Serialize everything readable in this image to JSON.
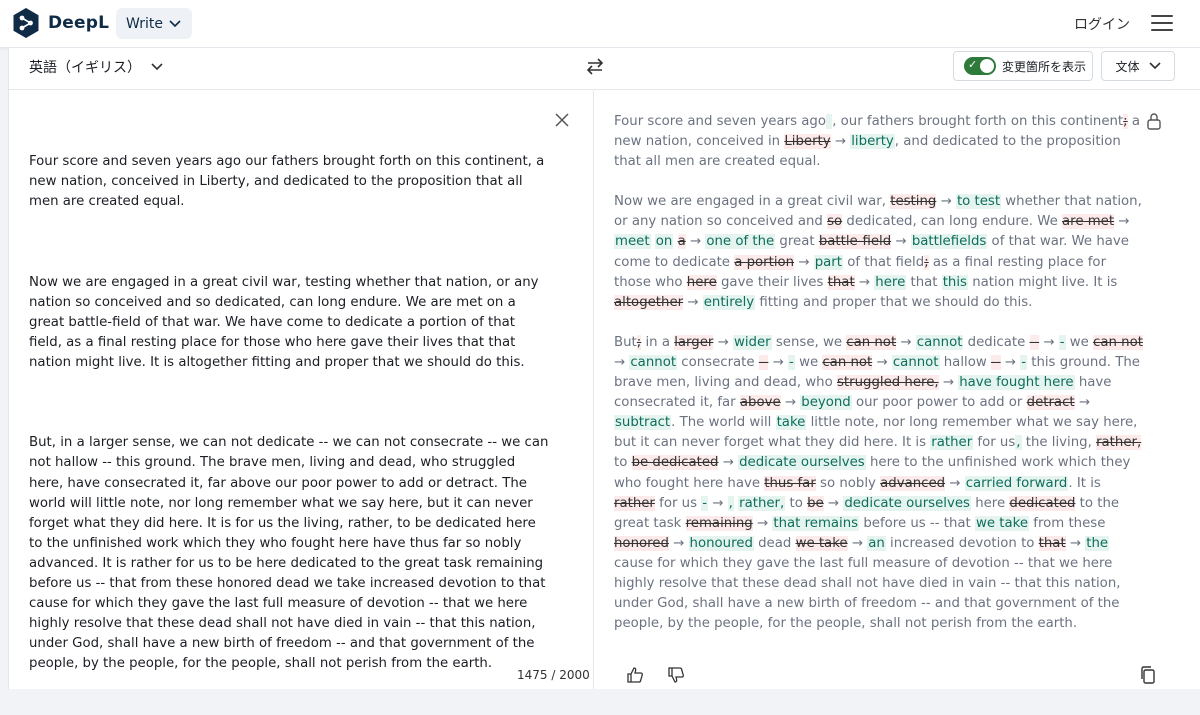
{
  "header": {
    "brand": "DeepL",
    "write_label": "Write",
    "login_label": "ログイン"
  },
  "source": {
    "language_label": "英語（イギリス）",
    "paragraphs": [
      "Four score and seven years ago our fathers brought forth on this continent, a new nation, conceived in Liberty, and dedicated to the proposition that all men are created equal.",
      "Now we are engaged in a great civil war, testing whether that nation, or any nation so conceived and so dedicated, can long endure. We are met on a great battle-field of that war. We have come to dedicate a portion of that field, as a final resting place for those who here gave their lives that that nation might live. It is altogether fitting and proper that we should do this.",
      "But, in a larger sense, we can not dedicate -- we can not consecrate -- we can not hallow -- this ground. The brave men, living and dead, who struggled here, have consecrated it, far above our poor power to add or detract. The world will little note, nor long remember what we say here, but it can never forget what they did here. It is for us the living, rather, to be dedicated here to the unfinished work which they who fought here have thus far so nobly advanced. It is rather for us to be here dedicated to the great task remaining before us -- that from these honored dead we take increased devotion to that cause for which they gave the last full measure of devotion -- that we here highly resolve that these dead shall not have died in vain -- that this nation, under God, shall have a new birth of freedom -- and that government of the people, by the people, for the people, shall not perish from the earth."
    ],
    "char_count": "1475 / 2000"
  },
  "target": {
    "show_changes_label": "変更箇所を表示",
    "style_label": "文体",
    "segments": [
      [
        {
          "t": "n",
          "s": "Four score and seven years ago"
        },
        {
          "t": "i",
          "s": " "
        },
        {
          "t": "n",
          "s": ", our fathers brought forth on this continent"
        },
        {
          "t": "d",
          "s": ";"
        },
        {
          "t": "n",
          "s": " a new nation, conceived in "
        },
        {
          "t": "d",
          "s": "Liberty"
        },
        {
          "t": "n",
          "s": " → "
        },
        {
          "t": "i",
          "s": "liberty"
        },
        {
          "t": "n",
          "s": ", and dedicated to the proposition that all men are created equal."
        }
      ],
      [
        {
          "t": "n",
          "s": "Now we are engaged in a great civil war, "
        },
        {
          "t": "d",
          "s": "testing"
        },
        {
          "t": "n",
          "s": " → "
        },
        {
          "t": "i",
          "s": "to test"
        },
        {
          "t": "n",
          "s": " whether that nation, or any nation so conceived and "
        },
        {
          "t": "d",
          "s": "so"
        },
        {
          "t": "n",
          "s": " dedicated, can long endure. We "
        },
        {
          "t": "d",
          "s": "are met"
        },
        {
          "t": "n",
          "s": " → "
        },
        {
          "t": "i",
          "s": "meet"
        },
        {
          "t": "n",
          "s": " "
        },
        {
          "t": "i",
          "s": "on"
        },
        {
          "t": "n",
          "s": " "
        },
        {
          "t": "d",
          "s": "a"
        },
        {
          "t": "n",
          "s": " → "
        },
        {
          "t": "i",
          "s": "one of the"
        },
        {
          "t": "n",
          "s": " great "
        },
        {
          "t": "d",
          "s": "battle-field"
        },
        {
          "t": "n",
          "s": " → "
        },
        {
          "t": "i",
          "s": "battlefields"
        },
        {
          "t": "n",
          "s": " of that war. We have come to dedicate "
        },
        {
          "t": "d",
          "s": "a portion"
        },
        {
          "t": "n",
          "s": " → "
        },
        {
          "t": "i",
          "s": "part"
        },
        {
          "t": "n",
          "s": " of that field"
        },
        {
          "t": "d",
          "s": ";"
        },
        {
          "t": "n",
          "s": " as a final resting place for those who "
        },
        {
          "t": "d",
          "s": "here"
        },
        {
          "t": "n",
          "s": " gave their lives "
        },
        {
          "t": "d",
          "s": "that"
        },
        {
          "t": "n",
          "s": " → "
        },
        {
          "t": "i",
          "s": "here"
        },
        {
          "t": "n",
          "s": " that "
        },
        {
          "t": "i",
          "s": "this"
        },
        {
          "t": "n",
          "s": " nation might live. It is "
        },
        {
          "t": "d",
          "s": "altogether"
        },
        {
          "t": "n",
          "s": " → "
        },
        {
          "t": "i",
          "s": "entirely"
        },
        {
          "t": "n",
          "s": " fitting and proper that we should do this."
        }
      ],
      [
        {
          "t": "n",
          "s": "But"
        },
        {
          "t": "d",
          "s": ";"
        },
        {
          "t": "n",
          "s": " in a "
        },
        {
          "t": "d",
          "s": "larger"
        },
        {
          "t": "n",
          "s": " → "
        },
        {
          "t": "i",
          "s": "wider"
        },
        {
          "t": "n",
          "s": " sense, we "
        },
        {
          "t": "d",
          "s": "can not"
        },
        {
          "t": "n",
          "s": " → "
        },
        {
          "t": "i",
          "s": "cannot"
        },
        {
          "t": "n",
          "s": " dedicate "
        },
        {
          "t": "d",
          "s": "--"
        },
        {
          "t": "n",
          "s": " → "
        },
        {
          "t": "i",
          "s": "-"
        },
        {
          "t": "n",
          "s": " we "
        },
        {
          "t": "d",
          "s": "can not"
        },
        {
          "t": "n",
          "s": " → "
        },
        {
          "t": "i",
          "s": "cannot"
        },
        {
          "t": "n",
          "s": " consecrate "
        },
        {
          "t": "d",
          "s": "--"
        },
        {
          "t": "n",
          "s": " → "
        },
        {
          "t": "i",
          "s": "-"
        },
        {
          "t": "n",
          "s": " we "
        },
        {
          "t": "d",
          "s": "can not"
        },
        {
          "t": "n",
          "s": " → "
        },
        {
          "t": "i",
          "s": "cannot"
        },
        {
          "t": "n",
          "s": " hallow "
        },
        {
          "t": "d",
          "s": "--"
        },
        {
          "t": "n",
          "s": " → "
        },
        {
          "t": "i",
          "s": "-"
        },
        {
          "t": "n",
          "s": " this ground. The brave men, living and dead, who "
        },
        {
          "t": "d",
          "s": "struggled here,"
        },
        {
          "t": "n",
          "s": " → "
        },
        {
          "t": "i",
          "s": "have fought here"
        },
        {
          "t": "n",
          "s": " have consecrated it, far "
        },
        {
          "t": "d",
          "s": "above"
        },
        {
          "t": "n",
          "s": " → "
        },
        {
          "t": "i",
          "s": "beyond"
        },
        {
          "t": "n",
          "s": " our poor power to add or "
        },
        {
          "t": "d",
          "s": "detract"
        },
        {
          "t": "n",
          "s": " → "
        },
        {
          "t": "i",
          "s": "subtract"
        },
        {
          "t": "n",
          "s": ". The world will "
        },
        {
          "t": "i",
          "s": "take"
        },
        {
          "t": "n",
          "s": " little note, nor long remember what we say here, but it can never forget what they did here. It is "
        },
        {
          "t": "i",
          "s": "rather"
        },
        {
          "t": "n",
          "s": " for us"
        },
        {
          "t": "i",
          "s": ","
        },
        {
          "t": "n",
          "s": " the living, "
        },
        {
          "t": "d",
          "s": "rather,"
        },
        {
          "t": "n",
          "s": " to "
        },
        {
          "t": "d",
          "s": "be dedicated"
        },
        {
          "t": "n",
          "s": " → "
        },
        {
          "t": "i",
          "s": "dedicate ourselves"
        },
        {
          "t": "n",
          "s": " here to the unfinished work which they who fought here have "
        },
        {
          "t": "d",
          "s": "thus far"
        },
        {
          "t": "n",
          "s": " so nobly "
        },
        {
          "t": "d",
          "s": "advanced"
        },
        {
          "t": "n",
          "s": " → "
        },
        {
          "t": "i",
          "s": "carried forward"
        },
        {
          "t": "n",
          "s": ". It is "
        },
        {
          "t": "d",
          "s": "rather"
        },
        {
          "t": "n",
          "s": " for us "
        },
        {
          "t": "i",
          "s": "-"
        },
        {
          "t": "n",
          "s": " → "
        },
        {
          "t": "i",
          "s": ","
        },
        {
          "t": "n",
          "s": " "
        },
        {
          "t": "i",
          "s": "rather,"
        },
        {
          "t": "n",
          "s": " to "
        },
        {
          "t": "d",
          "s": "be"
        },
        {
          "t": "n",
          "s": " → "
        },
        {
          "t": "i",
          "s": "dedicate ourselves"
        },
        {
          "t": "n",
          "s": " here "
        },
        {
          "t": "d",
          "s": "dedicated"
        },
        {
          "t": "n",
          "s": " to the great task "
        },
        {
          "t": "d",
          "s": "remaining"
        },
        {
          "t": "n",
          "s": " → "
        },
        {
          "t": "i",
          "s": "that remains"
        },
        {
          "t": "n",
          "s": " before us -- that "
        },
        {
          "t": "i",
          "s": "we take"
        },
        {
          "t": "n",
          "s": " from these "
        },
        {
          "t": "d",
          "s": "honored"
        },
        {
          "t": "n",
          "s": " → "
        },
        {
          "t": "i",
          "s": "honoured"
        },
        {
          "t": "n",
          "s": " dead "
        },
        {
          "t": "d",
          "s": "we take"
        },
        {
          "t": "n",
          "s": " → "
        },
        {
          "t": "i",
          "s": "an"
        },
        {
          "t": "n",
          "s": " increased devotion to "
        },
        {
          "t": "d",
          "s": "that"
        },
        {
          "t": "n",
          "s": " → "
        },
        {
          "t": "i",
          "s": "the"
        },
        {
          "t": "n",
          "s": " cause for which they gave the last full measure of devotion -- that we here highly resolve that these dead shall not have died in vain -- that this nation, under God, shall have a new birth of freedom -- and that government of the people, by the people, for the people, shall not perish from the earth."
        }
      ]
    ]
  },
  "icons": {
    "logo": "deepl-logo-icon",
    "chevron": "chevron-down-icon",
    "swap": "swap-languages-icon",
    "close": "close-icon",
    "lock": "lock-icon",
    "thumbs_up": "thumbs-up-icon",
    "thumbs_down": "thumbs-down-icon",
    "copy": "copy-icon",
    "menu": "hamburger-menu-icon"
  },
  "colors": {
    "brand": "#0f2b46",
    "toggle_on": "#2d7a3a",
    "insert_bg": "#e6f4f0",
    "insert_fg": "#0e6e5c",
    "delete_bg": "#fdeaea"
  }
}
